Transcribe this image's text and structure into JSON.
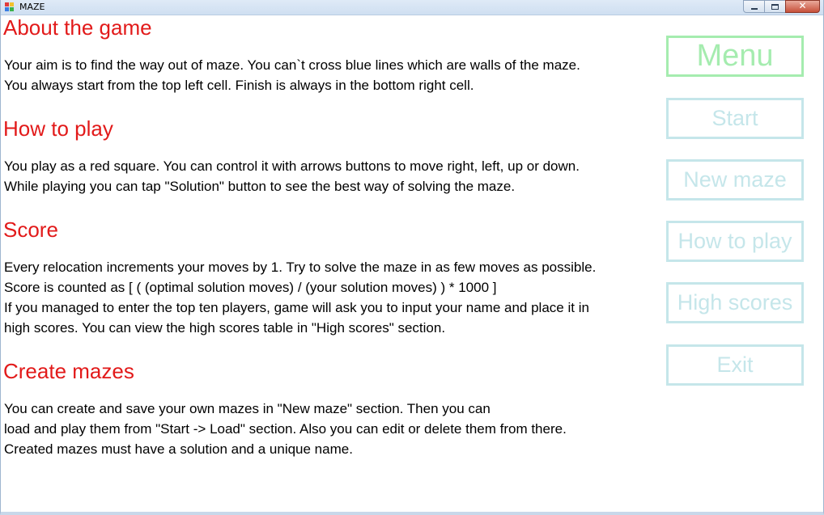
{
  "window": {
    "title": "MAZE",
    "icon": "maze-app-icon",
    "controls": {
      "minimize": "minimize-icon",
      "maximize": "maximize-icon",
      "close": "close-icon",
      "close_glyph": "✕"
    }
  },
  "sections": [
    {
      "title": "About the game",
      "lines": [
        "Your aim is to find the way out of maze. You can`t cross blue lines which are walls of the maze.",
        "You always start from the top left cell.  Finish is always in the bottom right cell."
      ]
    },
    {
      "title": "How to play",
      "lines": [
        "You play as a red square. You can control it with arrows buttons to move right, left, up or down.",
        "While playing you can tap \"Solution\" button to see the best way of solving the maze."
      ]
    },
    {
      "title": "Score",
      "lines": [
        "Every relocation increments your moves by 1. Try to solve the maze in as few moves as possible.",
        "Score is counted as [ ( (optimal solution moves) / (your solution moves) ) * 1000 ]",
        "If you managed to enter the top ten players, game will ask you to input your name and place it in",
        "high scores. You can view the high scores table in \"High scores\" section."
      ]
    },
    {
      "title": "Create mazes",
      "lines": [
        "You can create and save your own mazes in \"New maze\" section. Then you can",
        "load and play them from \"Start -> Load\" section. Also you can edit or delete them from there.",
        "Created mazes must have a solution and a unique name."
      ]
    }
  ],
  "menu": {
    "title": "Menu",
    "buttons": {
      "start": "Start",
      "new_maze": "New maze",
      "how_to_play": "How to play",
      "high_scores": "High scores",
      "exit": "Exit"
    }
  },
  "colors": {
    "section_title": "#e21a1a",
    "menu_title_border": "#a5ecaf",
    "button_border": "#c5e6ea",
    "close_button": "#c7503a"
  }
}
